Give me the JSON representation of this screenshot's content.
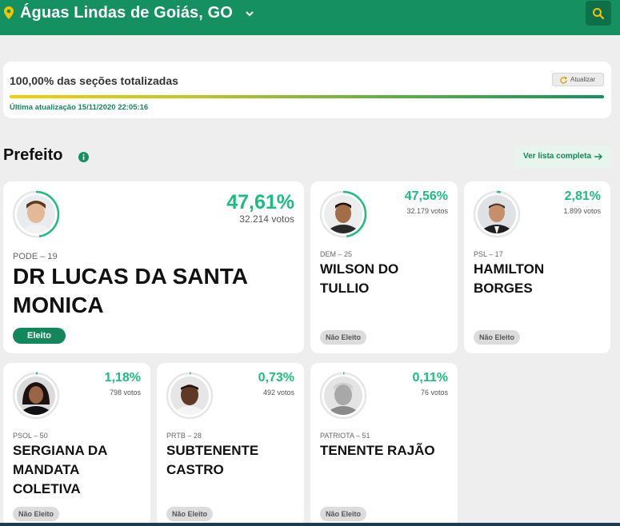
{
  "header": {
    "location": "Águas Lindas de Goiás, GO",
    "pin_icon": "map-pin-icon",
    "search_icon": "search-icon",
    "bg_color": "#159061"
  },
  "totals": {
    "sections_text": "100,00% das seções totalizadas",
    "update_button": "Atualizar",
    "progress": 1.0,
    "last_update": "Última atualização 15/11/2020 22:05:16"
  },
  "office": {
    "title": "Prefeito",
    "full_list_label": "Ver lista completa"
  },
  "candidates": [
    {
      "party": "PODE – 19",
      "name": "DR LUCAS DA SANTA MONICA",
      "percent": "47,61%",
      "percent_value": 47.61,
      "votes": "32.214 votos",
      "status": "Eleito",
      "elected": true
    },
    {
      "party": "DEM – 25",
      "name": "WILSON DO TULLIO",
      "percent": "47,56%",
      "percent_value": 47.56,
      "votes": "32.179 votos",
      "status": "Não Eleito",
      "elected": false
    },
    {
      "party": "PSL – 17",
      "name": "HAMILTON BORGES",
      "percent": "2,81%",
      "percent_value": 2.81,
      "votes": "1.899 votos",
      "status": "Não Eleito",
      "elected": false
    },
    {
      "party": "PSOL – 50",
      "name": "SERGIANA DA MANDATA COLETIVA",
      "percent": "1,18%",
      "percent_value": 1.18,
      "votes": "798 votos",
      "status": "Não Eleito",
      "elected": false
    },
    {
      "party": "PRTB – 28",
      "name": "SUBTENENTE CASTRO",
      "percent": "0,73%",
      "percent_value": 0.73,
      "votes": "492 votos",
      "status": "Não Eleito",
      "elected": false
    },
    {
      "party": "PATRIOTA – 51",
      "name": "TENENTE RAJÃO",
      "percent": "0,11%",
      "percent_value": 0.11,
      "votes": "76 votos",
      "status": "Não Eleito",
      "elected": false
    }
  ],
  "colors": {
    "accent": "#1dbd7f",
    "elected_badge": "#13875c",
    "ring_track": "#e6e6e6"
  }
}
